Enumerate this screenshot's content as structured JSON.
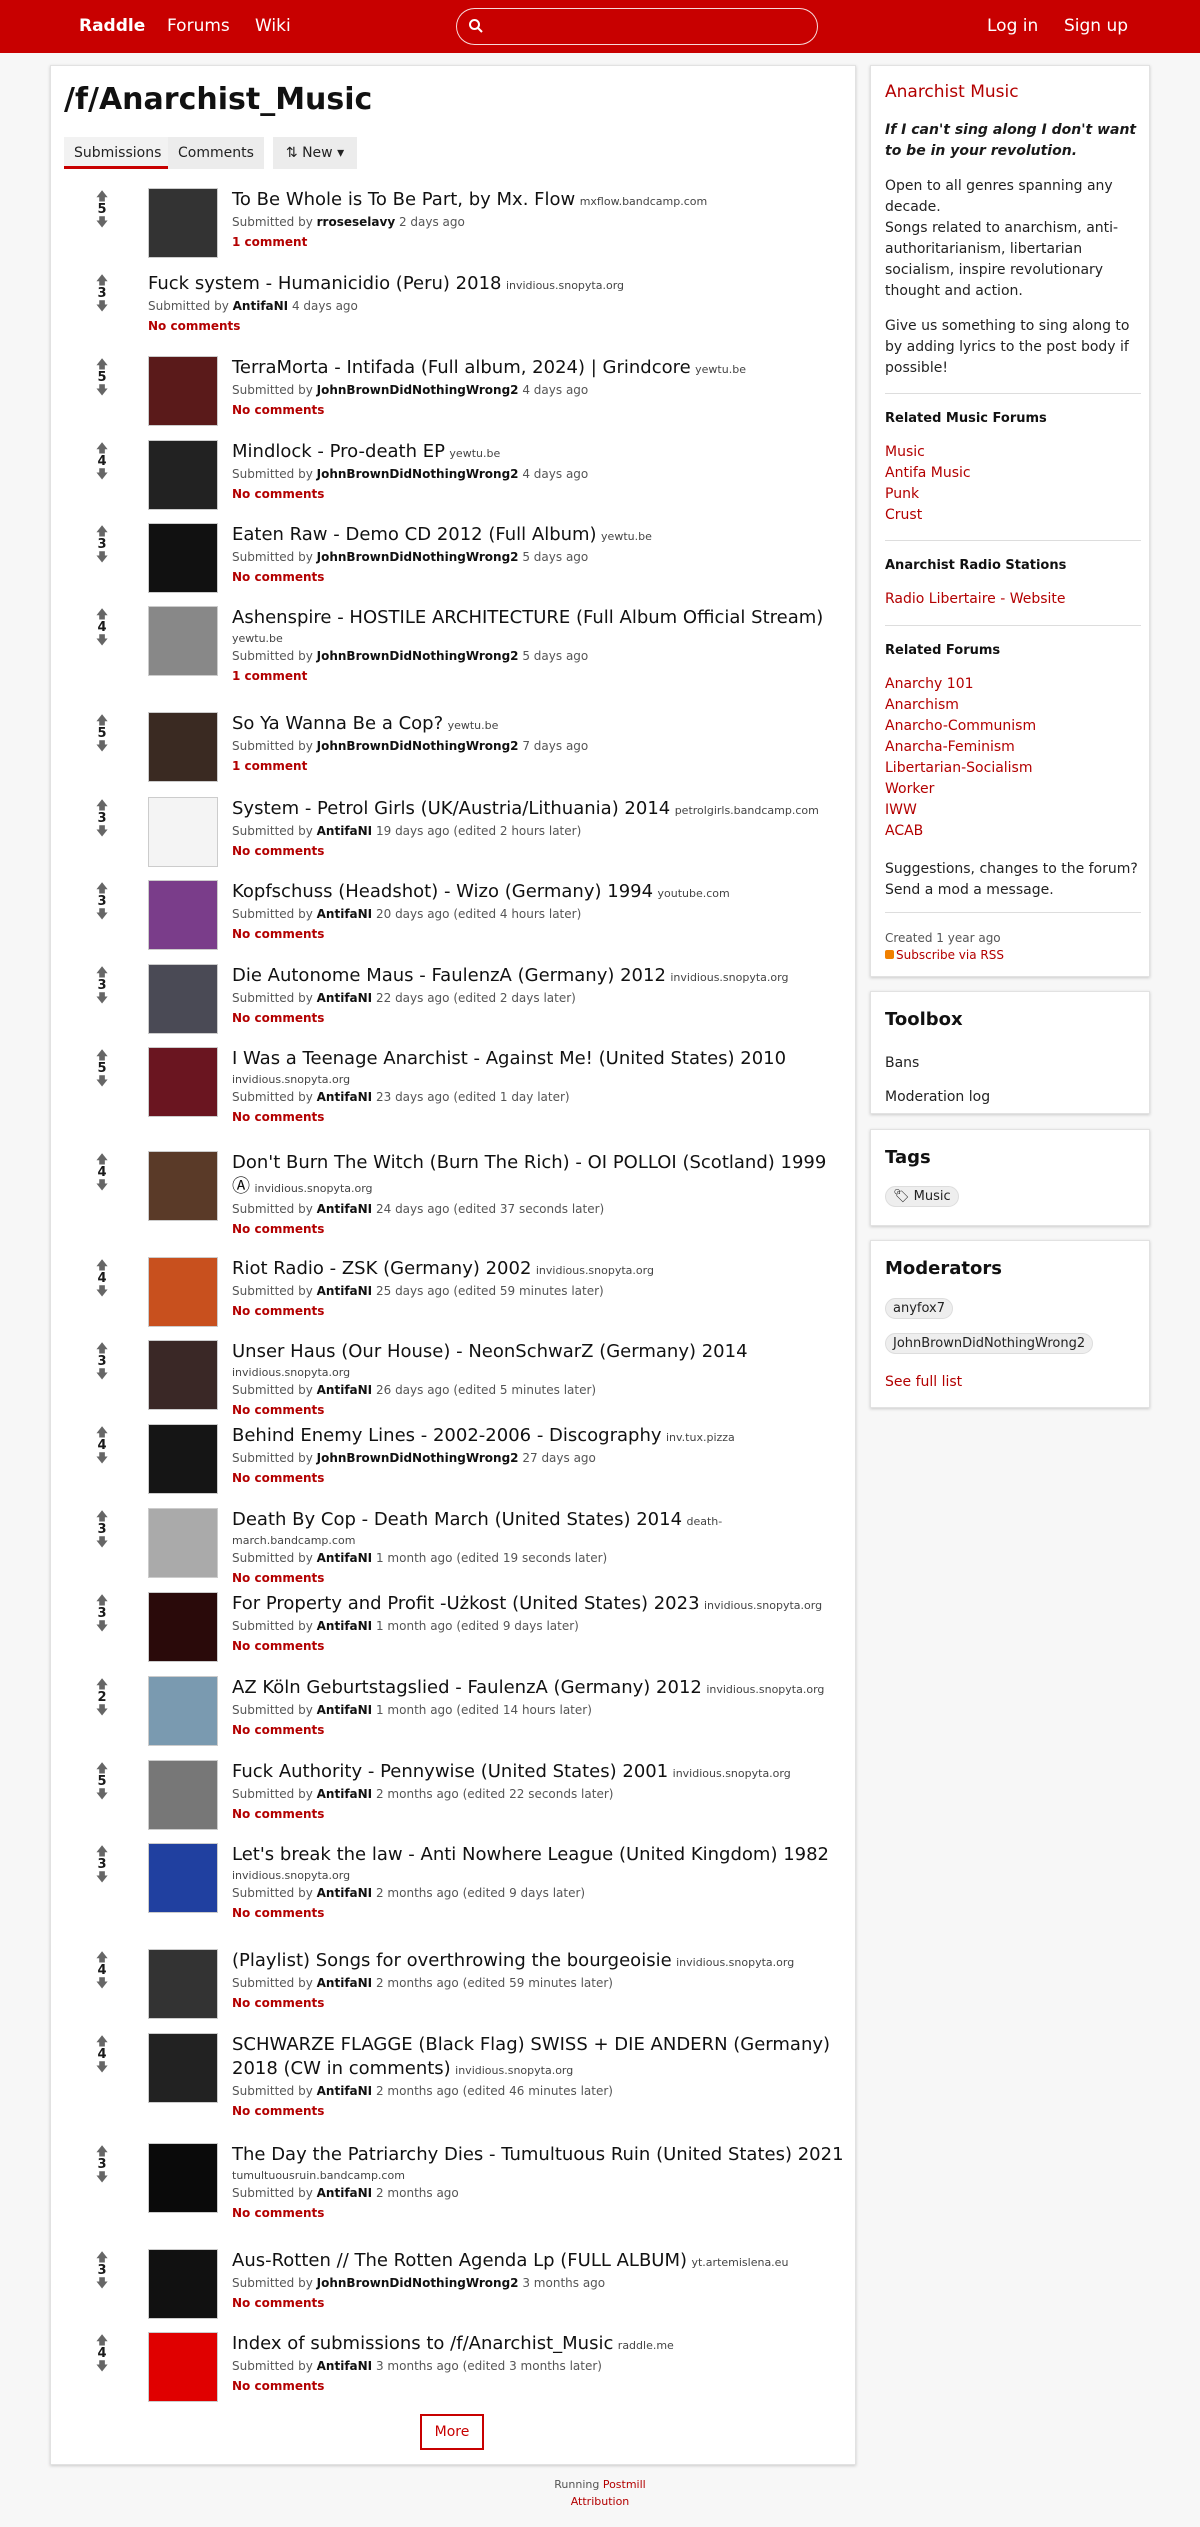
{
  "nav": {
    "brand": "Raddle",
    "forums": "Forums",
    "wiki": "Wiki",
    "login": "Log in",
    "signup": "Sign up",
    "search_placeholder": ""
  },
  "page": {
    "title": "/f/Anarchist_Music",
    "tabs": [
      "Submissions",
      "Comments"
    ],
    "sort_label": "New",
    "more_label": "More"
  },
  "submissions": [
    {
      "title": "To Be Whole is To Be Part, by Mx. Flow",
      "domain": "mxflow.bandcamp.com",
      "meta_prefix": "Submitted by",
      "user": "rroseselavy",
      "when": "2 days ago",
      "comments": "1 comment",
      "score": "5",
      "thumb": "#333"
    },
    {
      "title": "Fuck system - Humanicidio (Peru) 2018",
      "domain": "invidious.snopyta.org",
      "meta_prefix": "Submitted by",
      "user": "AntifaNI",
      "when": "4 days ago",
      "comments": "No comments",
      "score": "3",
      "thumb": ""
    },
    {
      "title": "TerraMorta - Intifada (Full album, 2024) | Grindcore",
      "domain": "yewtu.be",
      "meta_prefix": "Submitted by",
      "user": "JohnBrownDidNothingWrong2",
      "when": "4 days ago",
      "comments": "No comments",
      "score": "5",
      "thumb": "#5a1a1a"
    },
    {
      "title": "Mindlock - Pro-death EP",
      "domain": "yewtu.be",
      "meta_prefix": "Submitted by",
      "user": "JohnBrownDidNothingWrong2",
      "when": "4 days ago",
      "comments": "No comments",
      "score": "4",
      "thumb": "#222"
    },
    {
      "title": "Eaten Raw - Demo CD 2012 (Full Album)",
      "domain": "yewtu.be",
      "meta_prefix": "Submitted by",
      "user": "JohnBrownDidNothingWrong2",
      "when": "5 days ago",
      "comments": "No comments",
      "score": "3",
      "thumb": "#111"
    },
    {
      "title": "Ashenspire - HOSTILE ARCHITECTURE (Full Album Official Stream)",
      "domain": "yewtu.be",
      "meta_prefix": "Submitted by",
      "user": "JohnBrownDidNothingWrong2",
      "when": "5 days ago",
      "comments": "1 comment",
      "score": "4",
      "thumb": "#888"
    },
    {
      "title": "So Ya Wanna Be a Cop?",
      "domain": "yewtu.be",
      "meta_prefix": "Submitted by",
      "user": "JohnBrownDidNothingWrong2",
      "when": "7 days ago",
      "comments": "1 comment",
      "score": "5",
      "thumb": "#3a2a22"
    },
    {
      "title": "System - Petrol Girls (UK/Austria/Lithuania) 2014",
      "domain": "petrolgirls.bandcamp.com",
      "meta_prefix": "Submitted by",
      "user": "AntifaNI",
      "when": "19 days ago (edited 2 hours later)",
      "comments": "No comments",
      "score": "3",
      "thumb": "#f4f4f4"
    },
    {
      "title": "Kopfschuss (Headshot) - Wizo (Germany) 1994",
      "domain": "youtube.com",
      "meta_prefix": "Submitted by",
      "user": "AntifaNI",
      "when": "20 days ago (edited 4 hours later)",
      "comments": "No comments",
      "score": "3",
      "thumb": "#7a3d8a"
    },
    {
      "title": "Die Autonome Maus - FaulenzA (Germany) 2012",
      "domain": "invidious.snopyta.org",
      "meta_prefix": "Submitted by",
      "user": "AntifaNI",
      "when": "22 days ago (edited 2 days later)",
      "comments": "No comments",
      "score": "3",
      "thumb": "#4a4a55"
    },
    {
      "title": "I Was a Teenage Anarchist - Against Me! (United States) 2010",
      "domain": "invidious.snopyta.org",
      "meta_prefix": "Submitted by",
      "user": "AntifaNI",
      "when": "23 days ago (edited 1 day later)",
      "comments": "No comments",
      "score": "5",
      "thumb": "#6a1520"
    },
    {
      "title": "Don't Burn The Witch (Burn The Rich) - OI POLLOI (Scotland) 1999 Ⓐ",
      "domain": "invidious.snopyta.org",
      "meta_prefix": "Submitted by",
      "user": "AntifaNI",
      "when": "24 days ago (edited 37 seconds later)",
      "comments": "No comments",
      "score": "4",
      "thumb": "#5a3a28"
    },
    {
      "title": "Riot Radio - ZSK (Germany) 2002",
      "domain": "invidious.snopyta.org",
      "meta_prefix": "Submitted by",
      "user": "AntifaNI",
      "when": "25 days ago (edited 59 minutes later)",
      "comments": "No comments",
      "score": "4",
      "thumb": "#c8501e"
    },
    {
      "title": "Unser Haus (Our House) - NeonSchwarZ (Germany) 2014",
      "domain": "invidious.snopyta.org",
      "meta_prefix": "Submitted by",
      "user": "AntifaNI",
      "when": "26 days ago (edited 5 minutes later)",
      "comments": "No comments",
      "score": "3",
      "thumb": "#3a2826"
    },
    {
      "title": "Behind Enemy Lines - 2002-2006 - Discography",
      "domain": "inv.tux.pizza",
      "meta_prefix": "Submitted by",
      "user": "JohnBrownDidNothingWrong2",
      "when": "27 days ago",
      "comments": "No comments",
      "score": "4",
      "thumb": "#151515"
    },
    {
      "title": "Death By Cop - Death March (United States) 2014",
      "domain": "death-march.bandcamp.com",
      "meta_prefix": "Submitted by",
      "user": "AntifaNI",
      "when": "1 month ago (edited 19 seconds later)",
      "comments": "No comments",
      "score": "3",
      "thumb": "#aaa"
    },
    {
      "title": "For Property and Profit -Użkost (United States) 2023",
      "domain": "invidious.snopyta.org",
      "meta_prefix": "Submitted by",
      "user": "AntifaNI",
      "when": "1 month ago (edited 9 days later)",
      "comments": "No comments",
      "score": "3",
      "thumb": "#2a0a0a"
    },
    {
      "title": "AZ Köln Geburtstagslied - FaulenzA (Germany) 2012",
      "domain": "invidious.snopyta.org",
      "meta_prefix": "Submitted by",
      "user": "AntifaNI",
      "when": "1 month ago (edited 14 hours later)",
      "comments": "No comments",
      "score": "2",
      "thumb": "#7a9ab0"
    },
    {
      "title": "Fuck Authority - Pennywise (United States) 2001",
      "domain": "invidious.snopyta.org",
      "meta_prefix": "Submitted by",
      "user": "AntifaNI",
      "when": "2 months ago (edited 22 seconds later)",
      "comments": "No comments",
      "score": "5",
      "thumb": "#777"
    },
    {
      "title": "Let's break the law - Anti Nowhere League (United Kingdom) 1982",
      "domain": "invidious.snopyta.org",
      "meta_prefix": "Submitted by",
      "user": "AntifaNI",
      "when": "2 months ago (edited 9 days later)",
      "comments": "No comments",
      "score": "3",
      "thumb": "#2040a0"
    },
    {
      "title": "(Playlist) Songs for overthrowing the bourgeoisie",
      "domain": "invidious.snopyta.org",
      "meta_prefix": "Submitted by",
      "user": "AntifaNI",
      "when": "2 months ago (edited 59 minutes later)",
      "comments": "No comments",
      "score": "4",
      "thumb": "#333"
    },
    {
      "title": "SCHWARZE FLAGGE (Black Flag) SWISS + DIE ANDERN (Germany) 2018 (CW in comments)",
      "domain": "invidious.snopyta.org",
      "meta_prefix": "Submitted by",
      "user": "AntifaNI",
      "when": "2 months ago (edited 46 minutes later)",
      "comments": "No comments",
      "score": "4",
      "thumb": "#222"
    },
    {
      "title": "The Day the Patriarchy Dies - Tumultuous Ruin (United States) 2021",
      "domain": "tumultuousruin.bandcamp.com",
      "meta_prefix": "Submitted by",
      "user": "AntifaNI",
      "when": "2 months ago",
      "comments": "No comments",
      "score": "3",
      "thumb": "#0a0a0a"
    },
    {
      "title": "Aus-Rotten // The Rotten Agenda Lp (FULL ALBUM)",
      "domain": "yt.artemislena.eu",
      "meta_prefix": "Submitted by",
      "user": "JohnBrownDidNothingWrong2",
      "when": "3 months ago",
      "comments": "No comments",
      "score": "3",
      "thumb": "#111"
    },
    {
      "title": "Index of submissions to /f/Anarchist_Music",
      "domain": "raddle.me",
      "meta_prefix": "Submitted by",
      "user": "AntifaNI",
      "when": "3 months ago (edited 3 months later)",
      "comments": "No comments",
      "score": "4",
      "thumb": "#e00000"
    }
  ],
  "sidebar": {
    "forum_name": "Anarchist Music",
    "tagline": "If I can't sing along I don't want to be in your revolution.",
    "desc1": "Open to all genres spanning any decade.",
    "desc2": "Songs related to anarchism, anti-authoritarianism, libertarian socialism, inspire revolutionary thought and action.",
    "desc3": "Give us something to sing along to by adding lyrics to the post body if possible!",
    "related_music_heading": "Related Music Forums",
    "related_music": [
      "Music",
      "Antifa Music",
      "Punk",
      "Crust"
    ],
    "radio_heading": "Anarchist Radio Stations",
    "radio": [
      "Radio Libertaire - Website"
    ],
    "related_heading": "Related Forums",
    "related": [
      "Anarchy 101",
      "Anarchism",
      "Anarcho-Communism",
      "Anarcha-Feminism",
      "Libertarian-Socialism",
      "Worker",
      "IWW",
      "ACAB"
    ],
    "suggestions": "Suggestions, changes to the forum? Send a mod a message.",
    "created": "Created 1 year ago",
    "rss": "Subscribe via RSS",
    "toolbox_heading": "Toolbox",
    "toolbox": [
      "Bans",
      "Moderation log"
    ],
    "tags_heading": "Tags",
    "tag": "Music",
    "mods_heading": "Moderators",
    "mods": [
      "anyfox7",
      "JohnBrownDidNothingWrong2"
    ],
    "see_full_list": "See full list"
  },
  "footer": {
    "running": "Running",
    "postmill": "Postmill",
    "attribution": "Attribution"
  },
  "colors": {
    "brand": "#c80000",
    "link": "#b30000"
  }
}
